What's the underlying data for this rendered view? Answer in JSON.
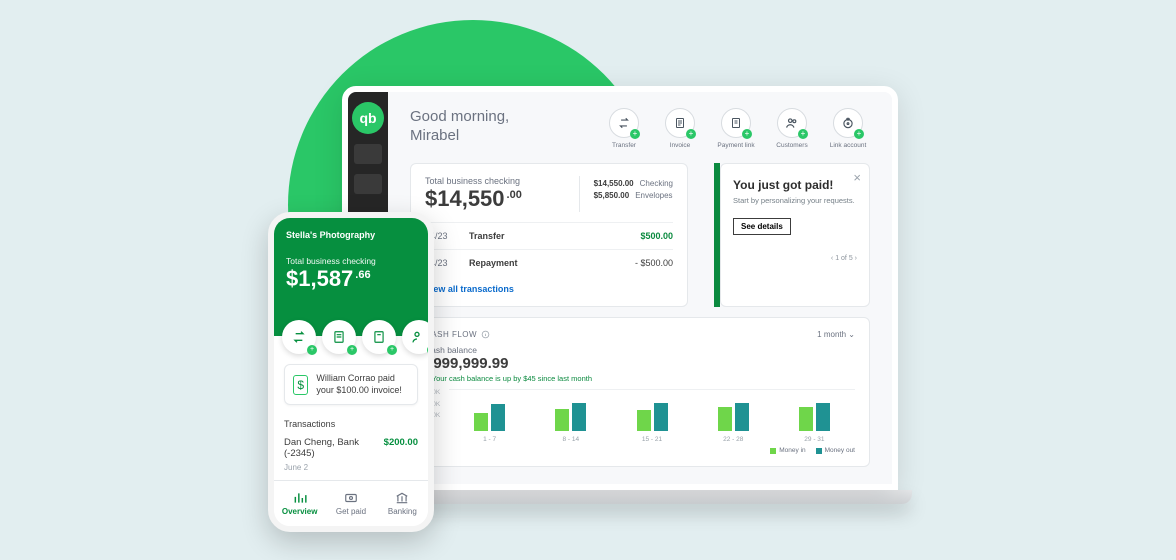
{
  "desktop": {
    "greeting_line1": "Good morning,",
    "greeting_line2": "Mirabel",
    "actions": [
      {
        "label": "Transfer"
      },
      {
        "label": "Invoice"
      },
      {
        "label": "Payment link"
      },
      {
        "label": "Customers"
      },
      {
        "label": "Link account"
      }
    ],
    "balance": {
      "label": "Total business checking",
      "amount_main": "$14,550",
      "amount_cents": ".00",
      "checking_amt": "$14,550.00",
      "checking_lbl": "Checking",
      "envelopes_amt": "$5,850.00",
      "envelopes_lbl": "Envelopes"
    },
    "transactions": [
      {
        "date": "04/23",
        "desc": "Transfer",
        "amount": "$500.00",
        "pos": true
      },
      {
        "date": "04/23",
        "desc": "Repayment",
        "amount": "- $500.00",
        "pos": false
      }
    ],
    "view_all": "View all transactions",
    "paid": {
      "title": "You just got paid!",
      "sub": "Start by personalizing your requests.",
      "button": "See details",
      "pager": "‹   1 of 5   ›"
    },
    "cashflow": {
      "heading": "CASH FLOW",
      "period": "1 month ⌄",
      "balance_label": "Cash balance",
      "amount": "$999,999.99",
      "trend": "Your cash balance is up by $45 since last month",
      "legend_in": "Money in",
      "legend_out": "Money out"
    }
  },
  "chart_data": {
    "type": "bar",
    "title": "Cash balance",
    "ylabel": "",
    "ylim": [
      0,
      600
    ],
    "y_ticks": [
      "600K",
      "400K",
      "200K",
      "0"
    ],
    "categories": [
      "1 - 7",
      "8 - 14",
      "15 - 21",
      "22 - 28",
      "29 - 31"
    ],
    "series": [
      {
        "name": "Money in",
        "values": [
          260,
          320,
          300,
          340,
          340
        ]
      },
      {
        "name": "Money out",
        "values": [
          380,
          400,
          400,
          400,
          400
        ]
      }
    ]
  },
  "phone": {
    "business": "Stella's Photography",
    "balance_label": "Total business checking",
    "amount_main": "$1,587",
    "amount_cents": ".66",
    "notification": "William Corrao paid your $100.00 invoice!",
    "tx_heading": "Transactions",
    "tx": {
      "name": "Dan Cheng, Bank (-2345)",
      "date": "June 2",
      "amount": "$200.00"
    },
    "nav": [
      {
        "label": "Overview",
        "active": true
      },
      {
        "label": "Get paid",
        "active": false
      },
      {
        "label": "Banking",
        "active": false
      }
    ]
  }
}
